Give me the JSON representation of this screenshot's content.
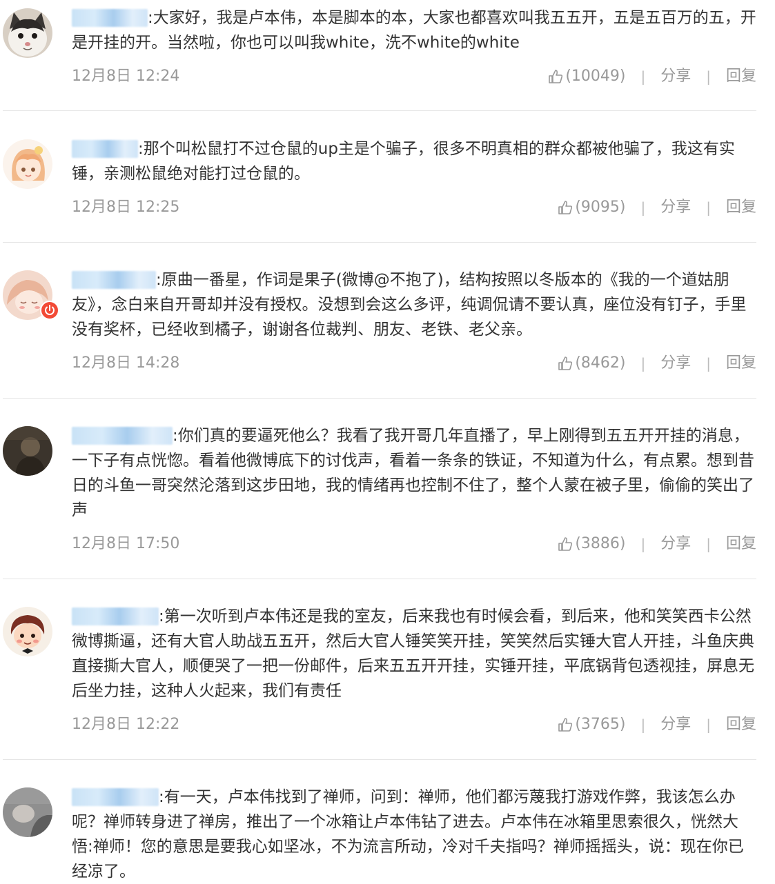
{
  "comments": [
    {
      "avatar": "cat-avatar",
      "text": "大家好，我是卢本伟，本是脚本的本，大家也都喜欢叫我五五开，五是五百万的五，开是开挂的开。当然啦，你也可以叫我white，洗不white的white",
      "time": "12月8日 12:24",
      "likes": "(10049)",
      "share": "分享",
      "reply": "回复"
    },
    {
      "avatar": "anime-girl-avatar",
      "text": "那个叫松鼠打不过仓鼠的up主是个骗子，很多不明真相的群众都被他骗了，我这有实锤，亲测松鼠绝对能打过仓鼠的。",
      "time": "12月8日 12:25",
      "likes": "(9095)",
      "share": "分享",
      "reply": "回复"
    },
    {
      "avatar": "anime-sleeping-avatar",
      "text": "原曲一番星，作词是果子(微博@不抱了)，结构按照以冬版本的《我的一个道姑朋友》，念白来自开哥却并没有授权。没想到会这么多评，纯调侃请不要认真，座位没有钉子，手里没有奖杯，已经收到橘子，谢谢各位裁判、朋友、老铁、老父亲。",
      "time": "12月8日 14:28",
      "likes": "(8462)",
      "share": "分享",
      "reply": "回复"
    },
    {
      "avatar": "dark-photo-avatar",
      "text": "你们真的要逼死他么？我看了我开哥几年直播了，早上刚得到五五开开挂的消息，一下子有点恍惚。看着他微博底下的讨伐声，看着一条条的铁证，不知道为什么，有点累。想到昔日的斗鱼一哥突然沦落到这步田地，我的情绪再也控制不住了，整个人蒙在被子里，偷偷的笑出了声",
      "time": "12月8日 17:50",
      "likes": "(3886)",
      "share": "分享",
      "reply": "回复"
    },
    {
      "avatar": "cartoon-boy-avatar",
      "text": "第一次听到卢本伟还是我的室友，后来我也有时候会看，到后来，他和笑笑西卡公然微博撕逼，还有大官人助战五五开，然后大官人锤笑笑开挂，笑笑然后实锤大官人开挂，斗鱼庆典直接撕大官人，顺便哭了一把一份邮件，后来五五开开挂，实锤开挂，平底锅背包透视挂，屏息无后坐力挂，这种人火起来，我们有责任",
      "time": "12月8日 12:22",
      "likes": "(3765)",
      "share": "分享",
      "reply": "回复"
    },
    {
      "avatar": "gray-photo-avatar",
      "text": "有一天，卢本伟找到了禅师，问到：禅师，他们都污蔑我打游戏作弊，我该怎么办呢？禅师转身进了禅房，推出了一个冰箱让卢本伟钻了进去。卢本伟在冰箱里思索很久，恍然大悟:禅师！您的意思是要我心如坚冰，不为流言所动，冷对千夫指吗？禅师摇摇头，说：现在你已经凉了。",
      "time": "",
      "likes": "",
      "share": "",
      "reply": ""
    }
  ]
}
